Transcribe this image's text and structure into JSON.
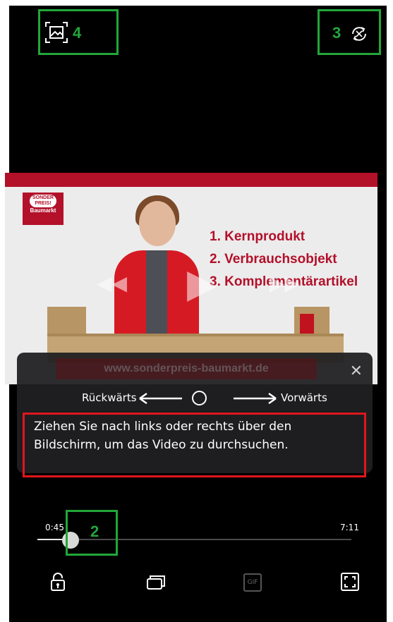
{
  "annotations": [
    {
      "label": "4"
    },
    {
      "label": "3"
    },
    {
      "label": "2"
    }
  ],
  "top_bar": {
    "left_icon": "image-frame-icon",
    "right_icon": "auto-rotate-icon"
  },
  "video": {
    "logo_lines": [
      "SONDER",
      "PREIS!",
      "Baumarkt"
    ],
    "list": [
      "1. Kernprodukt",
      "2. Verbrauchsobjekt",
      "3. Komplementärartikel"
    ],
    "footer_url": "www.sonderpreis-baumarkt.de"
  },
  "gesture_hint": {
    "backward_label": "Rückwärts",
    "forward_label": "Vorwärts",
    "description": "Ziehen Sie nach links oder rechts über den Bildschirm, um das Video zu durchsuchen.",
    "close_icon": "close-icon"
  },
  "playback": {
    "current_time": "0:45",
    "total_time": "7:11",
    "progress": 0.105
  },
  "bottom_bar": {
    "icons": [
      "lock-icon",
      "window-icon",
      "gif-icon",
      "fullscreen-icon"
    ],
    "gif_label": "GIF"
  },
  "colors": {
    "background": "#000000",
    "brand_red": "#b3102a",
    "highlight_green": "#22a63a",
    "highlight_red": "#e0161b"
  }
}
